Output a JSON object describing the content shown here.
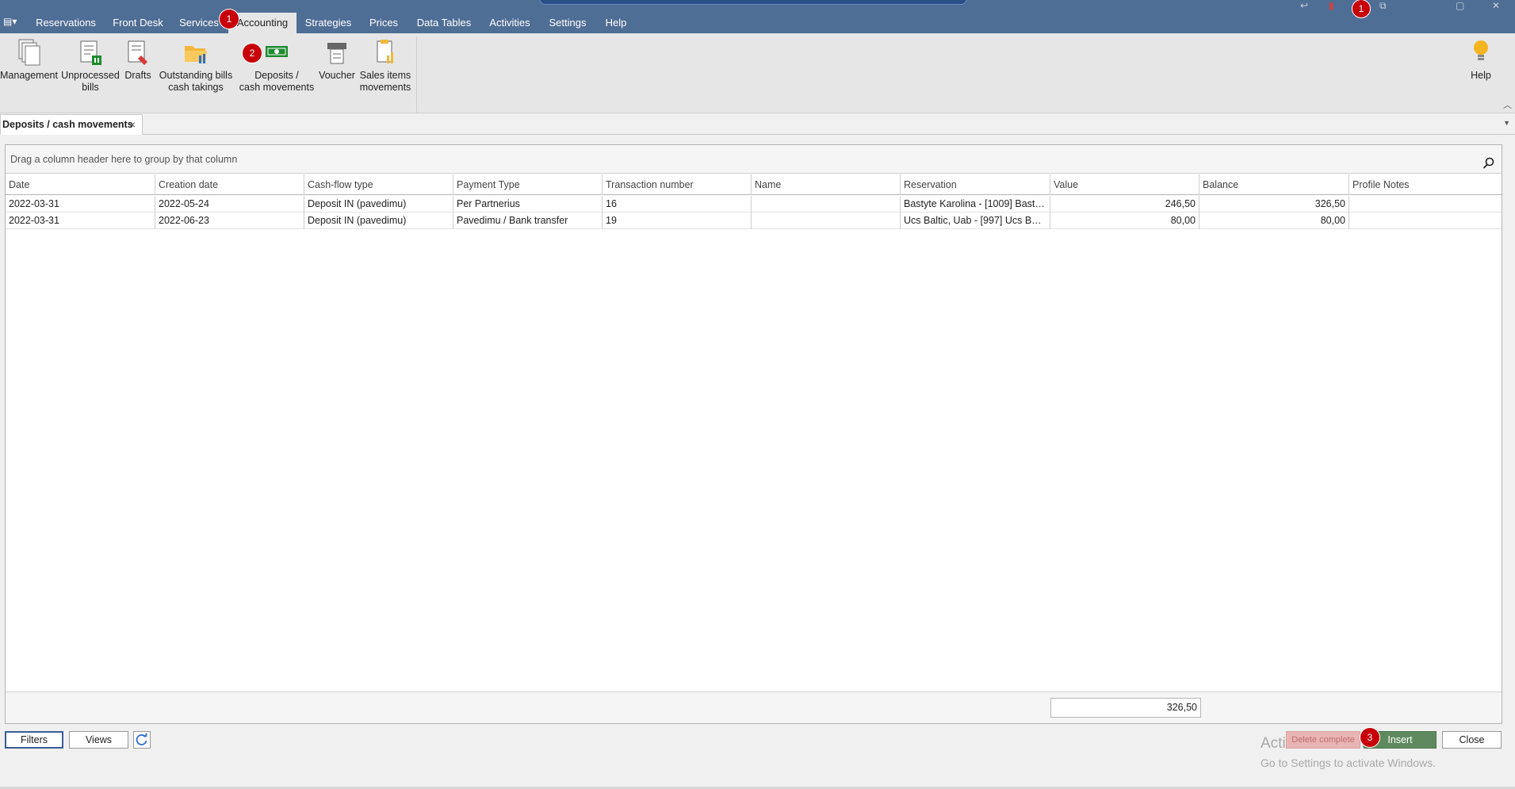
{
  "menu": {
    "tabs": [
      {
        "label": "Reservations"
      },
      {
        "label": "Front Desk"
      },
      {
        "label": "Services"
      },
      {
        "label": "Accounting"
      },
      {
        "label": "Strategies"
      },
      {
        "label": "Prices"
      },
      {
        "label": "Data Tables"
      },
      {
        "label": "Activities"
      },
      {
        "label": "Settings"
      },
      {
        "label": "Help"
      }
    ],
    "active_tab": "Accounting"
  },
  "ribbon": {
    "buttons": [
      {
        "label_line1": "Management",
        "label_line2": "",
        "icon": "management-icon"
      },
      {
        "label_line1": "Unprocessed",
        "label_line2": "bills",
        "icon": "unprocessed-bills-icon"
      },
      {
        "label_line1": "Drafts",
        "label_line2": "",
        "icon": "drafts-icon"
      },
      {
        "label_line1": "Outstanding bills",
        "label_line2": "cash takings",
        "icon": "folder-icon"
      },
      {
        "label_line1": "Deposits /",
        "label_line2": "cash movements",
        "icon": "cash-icon"
      },
      {
        "label_line1": "Voucher",
        "label_line2": "",
        "icon": "voucher-icon"
      },
      {
        "label_line1": "Sales items",
        "label_line2": "movements",
        "icon": "sales-items-icon"
      }
    ],
    "help_label": "Help"
  },
  "document_tab": {
    "label": "Deposits / cash movements"
  },
  "grid": {
    "group_hint": "Drag a column header here to group by that column",
    "columns": [
      "Date",
      "Creation date",
      "Cash-flow type",
      "Payment Type",
      "Transaction number",
      "Name",
      "Reservation",
      "Value",
      "Balance",
      "Profile Notes"
    ],
    "rows": [
      [
        "2022-03-31",
        "2022-05-24",
        "Deposit IN (pavedimu)",
        "Per Partnerius",
        "16",
        "",
        "Bastyte Karolina - [1009] Basty...",
        "246,50",
        "326,50",
        ""
      ],
      [
        "2022-03-31",
        "2022-06-23",
        "Deposit IN (pavedimu)",
        "Pavedimu / Bank transfer",
        "19",
        "",
        "Ucs Baltic, Uab  - [997] Ucs Bal...",
        "80,00",
        "80,00",
        ""
      ]
    ],
    "total_value": "326,50"
  },
  "bottom": {
    "filters_label": "Filters",
    "views_label": "Views",
    "delete_label": "Delete complete",
    "insert_label": "Insert",
    "close_label": "Close"
  },
  "watermark": {
    "line1": "Activate Windows",
    "line2": "Go to Settings to activate Windows."
  },
  "badges": {
    "b1": "1",
    "b2": "2",
    "b3": "3",
    "b_top": "1"
  },
  "colors": {
    "menubar": "#4f6e95",
    "badge": "#c8000a",
    "insert": "#5f8a5f"
  }
}
